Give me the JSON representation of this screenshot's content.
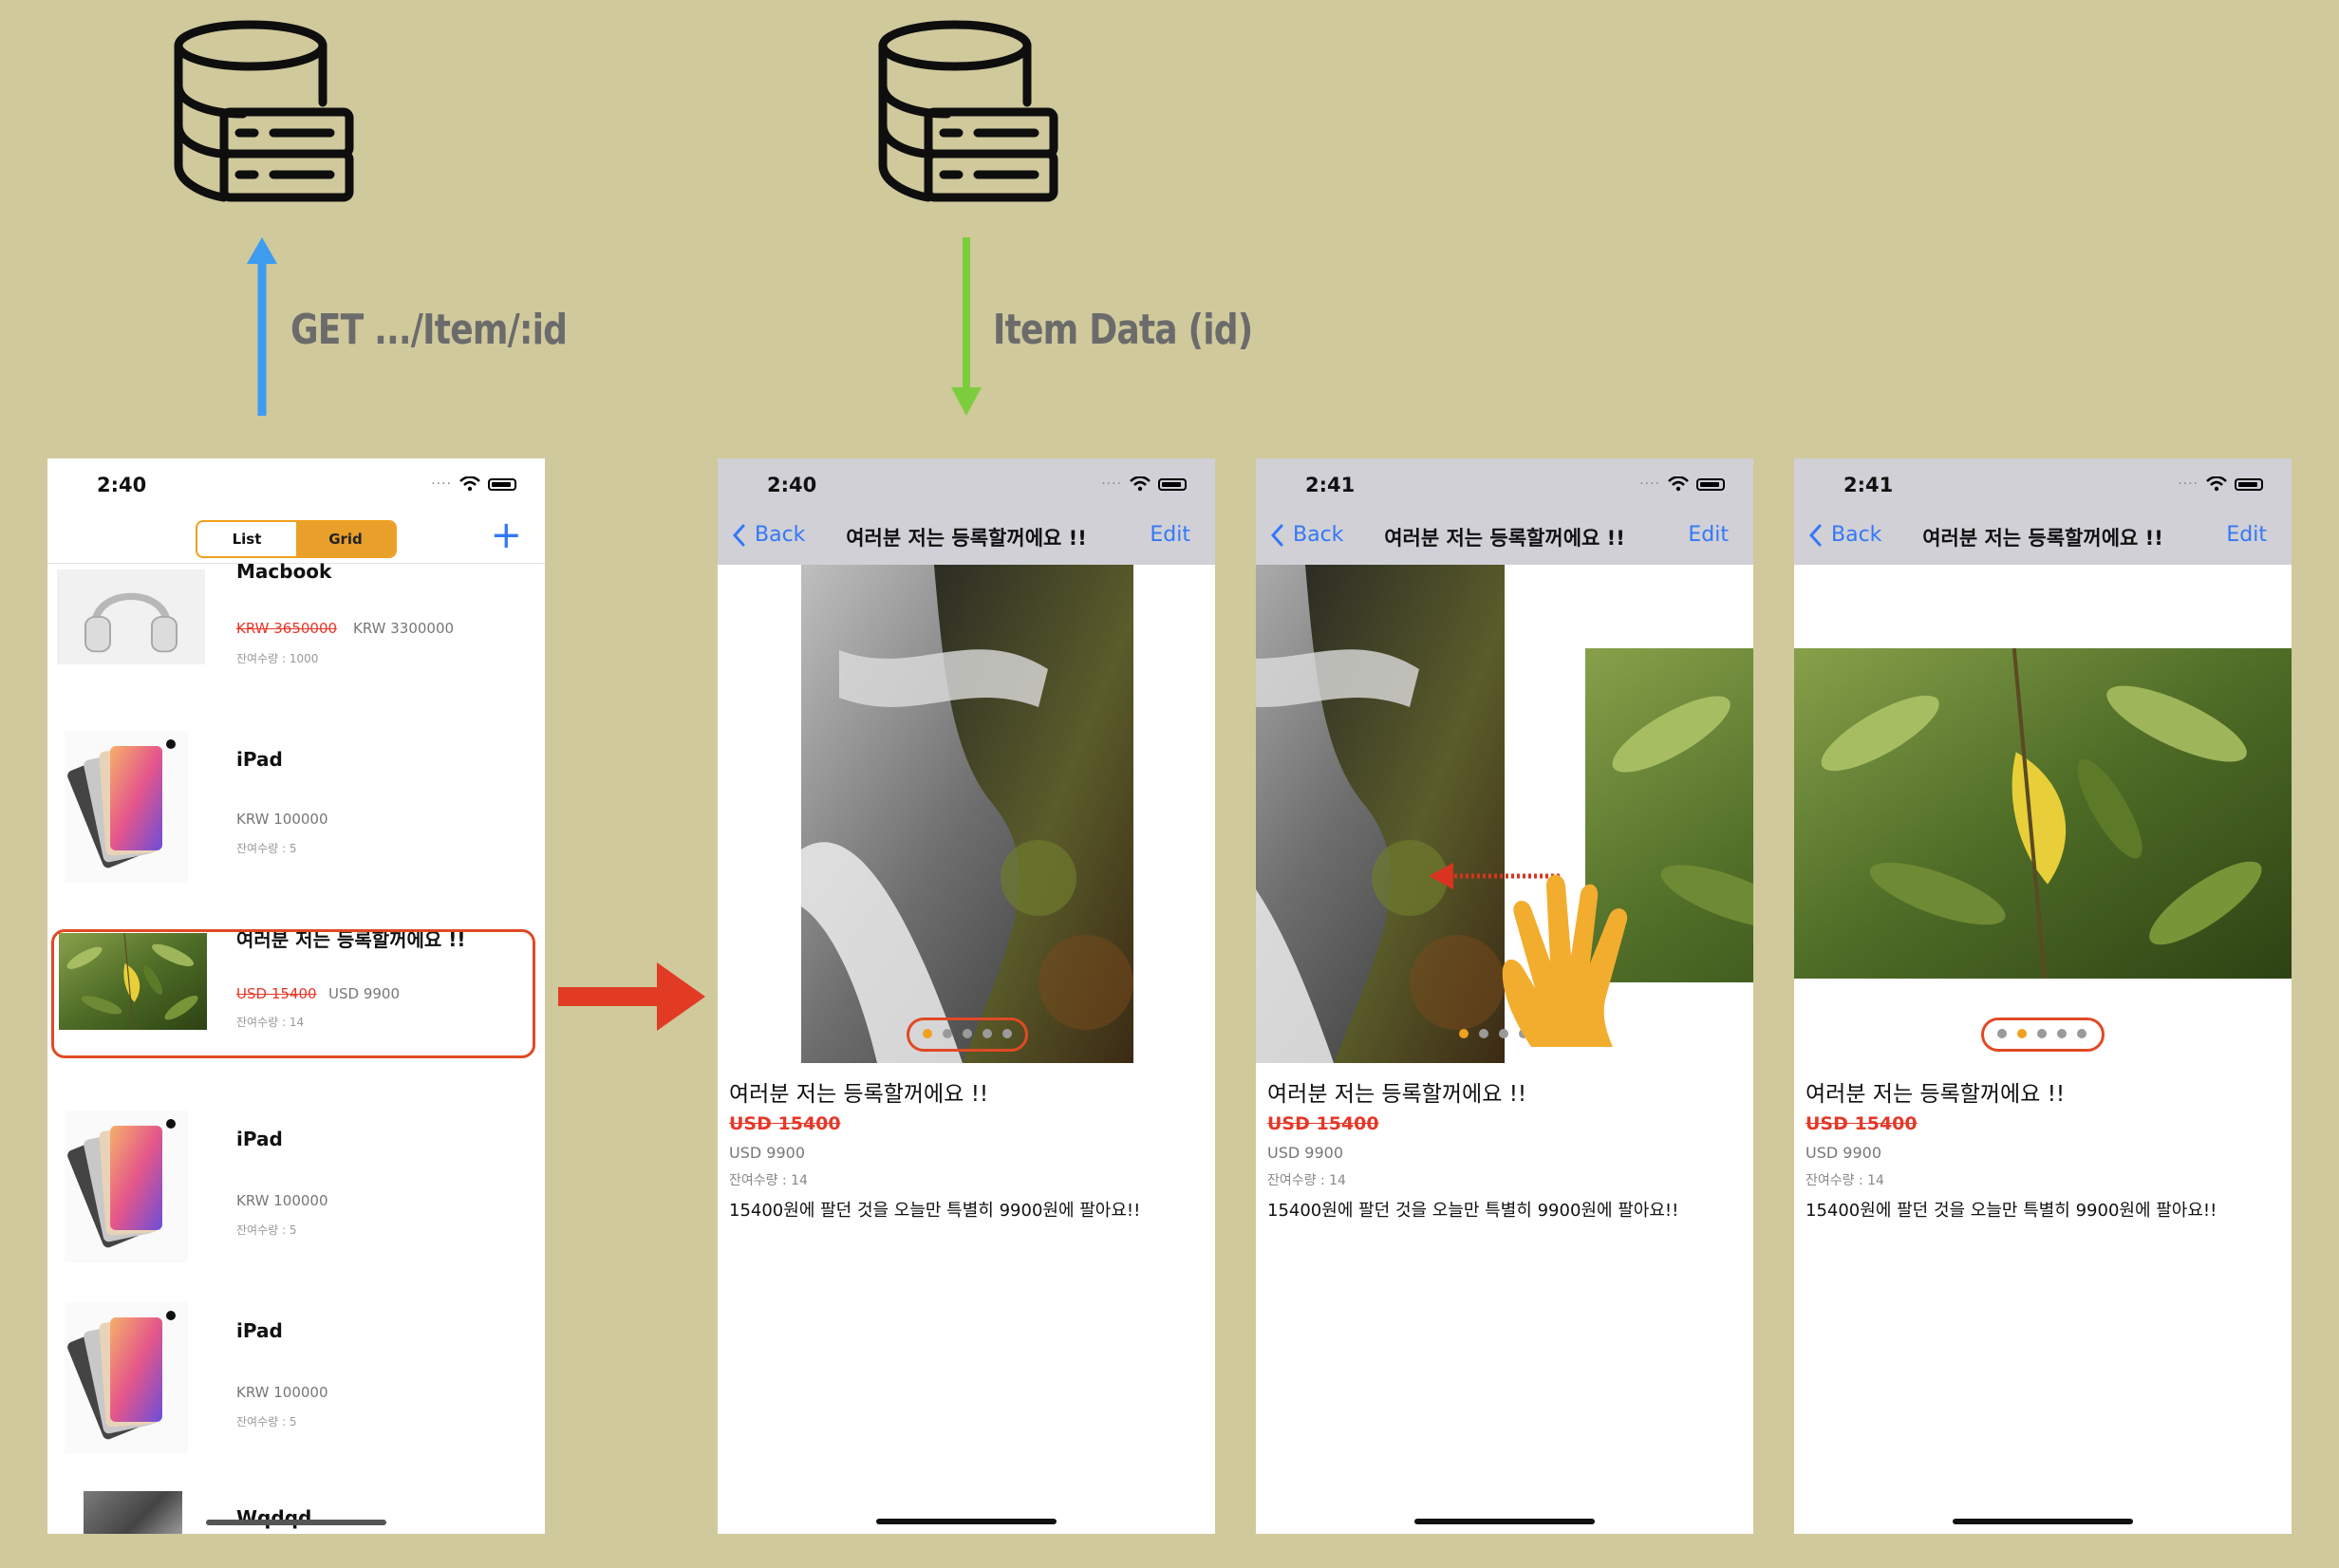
{
  "annotations": {
    "request_label": "GET  .../Item/:id",
    "response_label": "Item Data (id)",
    "database_icon_name": "database-server-icon",
    "colors": {
      "request_arrow": "#3d9bf0",
      "response_arrow": "#7ccd3e",
      "transition_arrow": "#e23b24",
      "highlight": "#e04a25"
    }
  },
  "list_screen": {
    "status_time": "2:40",
    "segment": {
      "list_label": "List",
      "grid_label": "Grid",
      "selected": "Grid"
    },
    "add_label": "+",
    "items": [
      {
        "title": "Macbook",
        "orig_price": "KRW 3650000",
        "price": "KRW 3300000",
        "stock": "잔여수량 : 1000",
        "thumb": "headphones"
      },
      {
        "title": "iPad",
        "orig_price": "",
        "price": "KRW 100000",
        "stock": "잔여수량 : 5",
        "thumb": "ipad"
      },
      {
        "title": "여러분 저는 등록할꺼에요 !!",
        "orig_price": "USD 15400",
        "price": "USD 9900",
        "stock": "잔여수량 : 14",
        "thumb": "leaves",
        "highlighted": true
      },
      {
        "title": "iPad",
        "orig_price": "",
        "price": "KRW 100000",
        "stock": "잔여수량 : 5",
        "thumb": "ipad"
      },
      {
        "title": "iPad",
        "orig_price": "",
        "price": "KRW 100000",
        "stock": "잔여수량 : 5",
        "thumb": "ipad"
      },
      {
        "title": "Wqdqd",
        "thumb": "rock"
      }
    ]
  },
  "detail_screens": [
    {
      "status_time": "2:40",
      "back_label": "Back",
      "nav_title": "여러분 저는 등록할꺼에요 !!",
      "edit_label": "Edit",
      "active_page": 0
    },
    {
      "status_time": "2:41",
      "back_label": "Back",
      "nav_title": "여러분 저는 등록할꺼에요 !!",
      "edit_label": "Edit",
      "active_page": 0
    },
    {
      "status_time": "2:41",
      "back_label": "Back",
      "nav_title": "여러분 저는 등록할꺼에요 !!",
      "edit_label": "Edit",
      "active_page": 1
    }
  ],
  "detail": {
    "name": "여러분 저는 등록할꺼에요 !!",
    "orig_price": "USD 15400",
    "price": "USD 9900",
    "stock": "잔여수량 : 14",
    "description": "15400원에 팔던 것을 오늘만 특별히 9900원에 팔아요!!",
    "page_count": 5
  },
  "gesture": {
    "icon_name": "swipe-hand-icon",
    "direction": "left",
    "color": "#f2ad2e"
  }
}
